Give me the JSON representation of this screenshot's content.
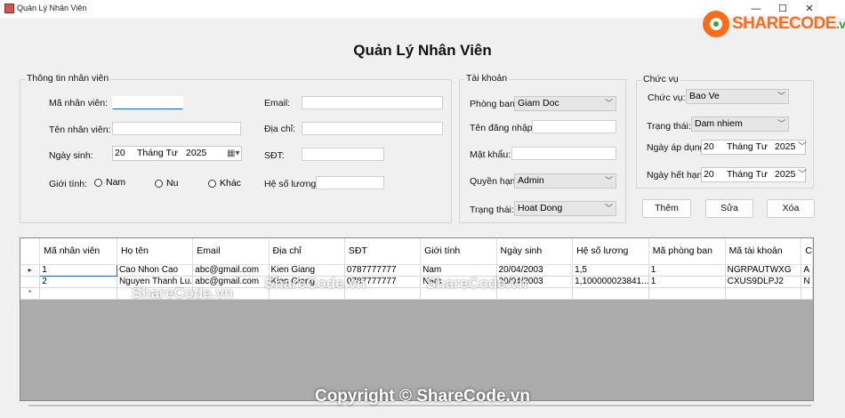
{
  "window": {
    "title": "Quản Lý Nhân Viên",
    "minimize": "—",
    "maximize": "☐",
    "close": "✕"
  },
  "logo": {
    "brand": "SHARECODE",
    "domain": ".vn"
  },
  "heading": "Quản Lý Nhân Viên",
  "employee_info": {
    "legend": "Thông tin nhân viên",
    "id_label": "Mã nhân viên:",
    "id_value": "",
    "name_label": "Tên nhân viên:",
    "name_value": "",
    "dob_label": "Ngày sinh:",
    "dob": {
      "day": "20",
      "month": "Tháng Tư",
      "year": "2025"
    },
    "gender_label": "Giới tính:",
    "gender_options": [
      "Nam",
      "Nu",
      "Khác"
    ],
    "email_label": "Email:",
    "email_value": "",
    "address_label": "Địa chỉ:",
    "address_value": "",
    "phone_label": "SĐT:",
    "phone_value": "",
    "coef_label": "Hệ số lương:",
    "coef_value": ""
  },
  "account": {
    "legend": "Tài khoản",
    "dept_label": "Phòng ban:",
    "dept_value": "Giam Doc",
    "username_label": "Tên đăng nhập:",
    "username_value": "",
    "password_label": "Mật khẩu:",
    "password_value": "",
    "role_label": "Quyền hạn:",
    "role_value": "Admin",
    "status_label": "Trạng thái:",
    "status_value": "Hoat Dong"
  },
  "position": {
    "legend": "Chức vụ",
    "pos_label": "Chức vụ:",
    "pos_value": "Bao Ve",
    "status_label": "Trạng thái:",
    "status_value": "Dam nhiem",
    "start_label": "Ngày áp dụng:",
    "start": {
      "day": "20",
      "month": "Tháng Tư",
      "year": "2025"
    },
    "end_label": "Ngày hết hạn:",
    "end": {
      "day": "20",
      "month": "Tháng Tư",
      "year": "2025"
    }
  },
  "buttons": {
    "add": "Thêm",
    "edit": "Sửa",
    "delete": "Xóa"
  },
  "table": {
    "columns": [
      "Mã nhân viên",
      "Họ tên",
      "Email",
      "Địa chỉ",
      "SĐT",
      "Giới tính",
      "Ngày sinh",
      "Hệ số lương",
      "Mã phòng ban",
      "Mã tài khoản",
      "C"
    ],
    "rows": [
      [
        "1",
        "Cao Nhon Cao",
        "abc@gmail.com",
        "Kien Giang",
        "0787777777",
        "Nam",
        "20/04/2003",
        "1,5",
        "1",
        "NGRPAUTWXG",
        "A"
      ],
      [
        "2",
        "Nguyen Thanh Lu...",
        "abc@gmail.com",
        "Kien Giang",
        "0787777777",
        "Nam",
        "20/04/2003",
        "1,100000023841...",
        "1",
        "CXUS9DLPJ2",
        "N"
      ]
    ],
    "row_markers": [
      "▸",
      "",
      "*"
    ]
  },
  "watermarks": {
    "small": "ShareCode.vn",
    "big": "Copyright © ShareCode.vn"
  }
}
